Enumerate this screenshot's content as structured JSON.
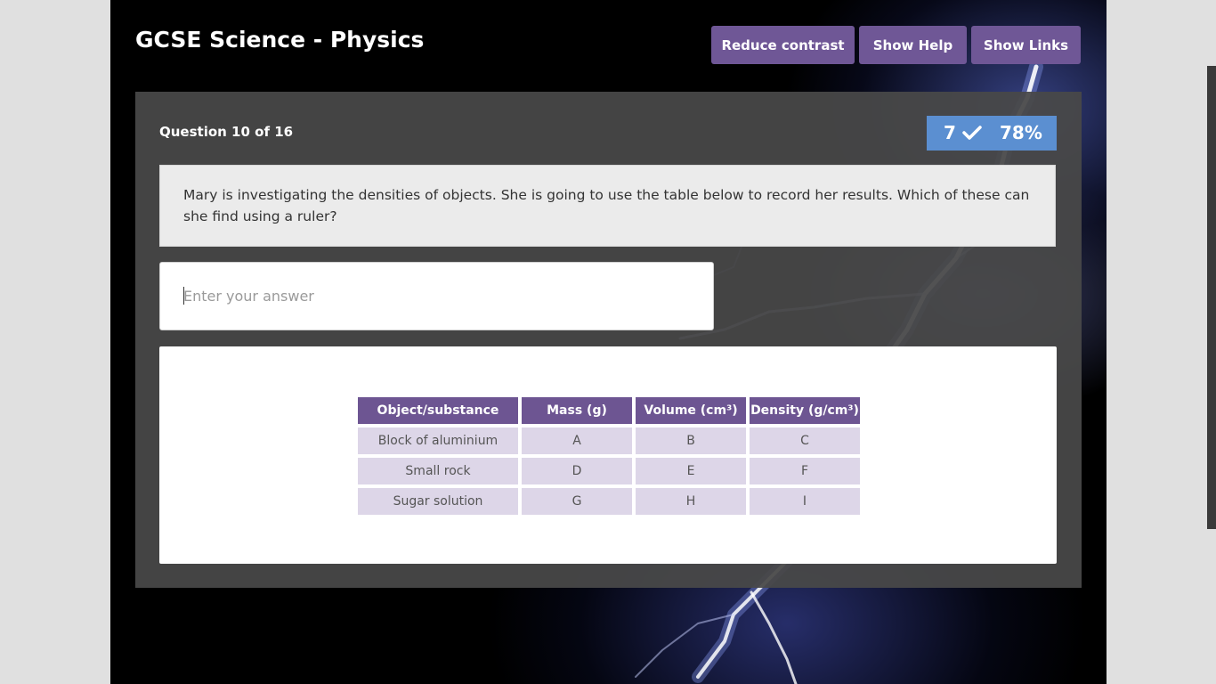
{
  "app": {
    "title": "GCSE Science - Physics"
  },
  "header": {
    "buttons": {
      "reduce_contrast": "Reduce contrast",
      "show_help": "Show Help",
      "show_links": "Show Links"
    }
  },
  "quiz": {
    "progress_label": "Question 10 of 16",
    "score": {
      "correct_count": "7",
      "percent": "78%",
      "icon": "check-icon"
    },
    "question": "Mary is investigating the densities of objects. She is going to use the table below to record her results. Which of these can she find using a ruler?",
    "answer": {
      "value": "",
      "placeholder": "Enter your answer"
    },
    "table": {
      "headers": [
        "Object/substance",
        "Mass (g)",
        "Volume (cm³)",
        "Density (g/cm³)"
      ],
      "rows": [
        [
          "Block of aluminium",
          "A",
          "B",
          "C"
        ],
        [
          "Small rock",
          "D",
          "E",
          "F"
        ],
        [
          "Sugar solution",
          "G",
          "H",
          "I"
        ]
      ]
    }
  },
  "colors": {
    "accent_purple": "#6f5796",
    "score_blue": "#5b8fd1",
    "table_header": "#6d5592",
    "table_cell": "#ddd6e8",
    "panel": "#484848"
  }
}
